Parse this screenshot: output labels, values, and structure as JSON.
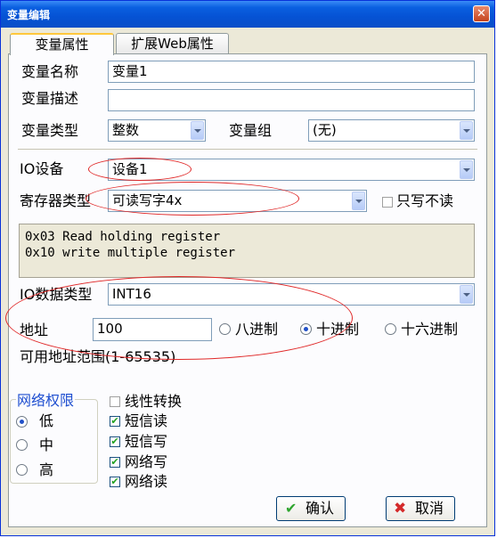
{
  "window": {
    "title": "变量编辑",
    "close_glyph": "✕"
  },
  "tabs": [
    {
      "label": "变量属性",
      "active": true
    },
    {
      "label": "扩展Web属性",
      "active": false
    }
  ],
  "fields": {
    "name_label": "变量名称",
    "name_value": "变量1",
    "desc_label": "变量描述",
    "desc_value": "",
    "type_label": "变量类型",
    "type_value": "整数",
    "group_label": "变量组",
    "group_value": "(无)",
    "io_device_label": "IO设备",
    "io_device_value": "设备1",
    "register_label": "寄存器类型",
    "register_value": "可读写字4x",
    "write_only_label": "只写不读",
    "write_only_checked": false,
    "register_desc_lines": [
      "0x03 Read holding register",
      "0x10 write multiple register"
    ],
    "io_data_type_label": "IO数据类型",
    "io_data_type_value": "INT16",
    "address_label": "地址",
    "address_value": "100",
    "radix_options": [
      {
        "label": "八进制",
        "selected": false
      },
      {
        "label": "十进制",
        "selected": true
      },
      {
        "label": "十六进制",
        "selected": false
      }
    ],
    "address_range": "可用地址范围(1-65535)"
  },
  "network_permission": {
    "title": "网络权限",
    "options": [
      {
        "label": "低",
        "selected": true
      },
      {
        "label": "中",
        "selected": false
      },
      {
        "label": "高",
        "selected": false
      }
    ]
  },
  "checkboxes": [
    {
      "label": "线性转换",
      "checked": false
    },
    {
      "label": "短信读",
      "checked": true
    },
    {
      "label": "短信写",
      "checked": true
    },
    {
      "label": "网络写",
      "checked": true
    },
    {
      "label": "网络读",
      "checked": true
    }
  ],
  "buttons": {
    "ok_label": "确认",
    "cancel_label": "取消"
  },
  "colors": {
    "titlebar": "#0a5fe0",
    "annotation": "#e02828",
    "ok_icon": "#2fa52f",
    "cancel_icon": "#d42a2a"
  }
}
